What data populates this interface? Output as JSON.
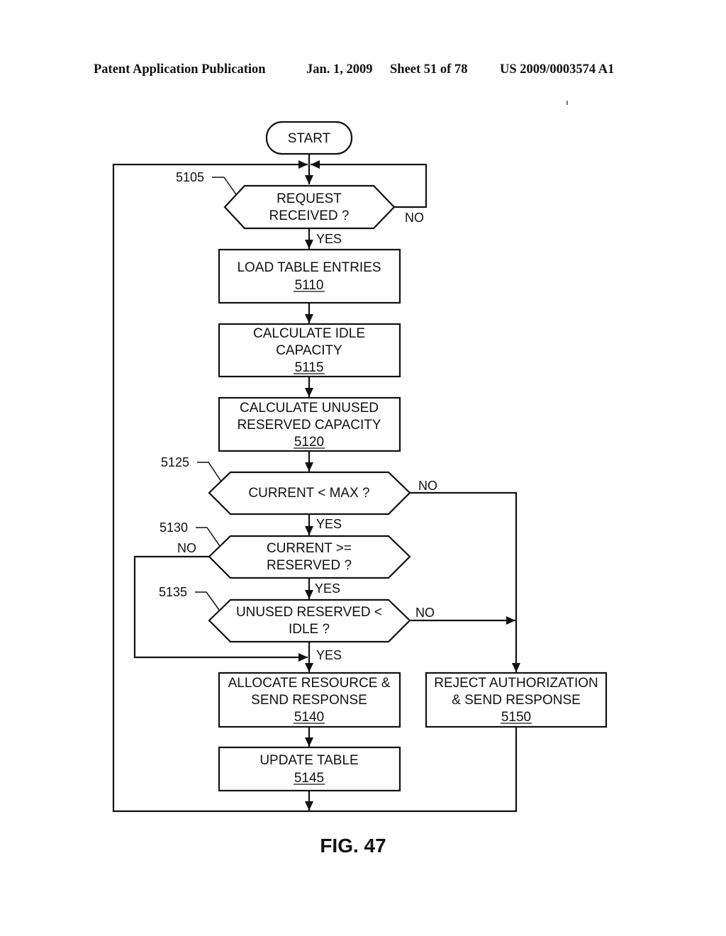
{
  "header": {
    "publication": "Patent Application Publication",
    "date": "Jan. 1, 2009",
    "sheet": "Sheet 51 of 78",
    "number": "US 2009/0003574 A1"
  },
  "figure": {
    "label": "FIG. 47"
  },
  "nodes": {
    "start": {
      "type": "terminal",
      "lines": [
        "START"
      ]
    },
    "n5105": {
      "type": "decision",
      "ref": "5105",
      "lines": [
        "REQUEST",
        "RECEIVED ?"
      ]
    },
    "n5110": {
      "type": "process",
      "ref": "5110",
      "lines": [
        "LOAD TABLE ENTRIES"
      ]
    },
    "n5115": {
      "type": "process",
      "ref": "5115",
      "lines": [
        "CALCULATE IDLE",
        "CAPACITY"
      ]
    },
    "n5120": {
      "type": "process",
      "ref": "5120",
      "lines": [
        "CALCULATE UNUSED",
        "RESERVED CAPACITY"
      ]
    },
    "n5125": {
      "type": "decision",
      "ref": "5125",
      "lines": [
        "CURRENT < MAX ?"
      ]
    },
    "n5130": {
      "type": "decision",
      "ref": "5130",
      "lines": [
        "CURRENT >=",
        "RESERVED ?"
      ]
    },
    "n5135": {
      "type": "decision",
      "ref": "5135",
      "lines": [
        "UNUSED RESERVED <",
        "IDLE ?"
      ]
    },
    "n5140": {
      "type": "process",
      "ref": "5140",
      "lines": [
        "ALLOCATE RESOURCE &",
        "SEND RESPONSE"
      ]
    },
    "n5145": {
      "type": "process",
      "ref": "5145",
      "lines": [
        "UPDATE TABLE"
      ]
    },
    "n5150": {
      "type": "process",
      "ref": "5150",
      "lines": [
        "REJECT AUTHORIZATION",
        "& SEND RESPONSE"
      ]
    }
  },
  "edges": {
    "e5105_no": {
      "from": "5105",
      "to": "5105",
      "label": "NO"
    },
    "e5105_yes": {
      "from": "5105",
      "to": "5110",
      "label": "YES"
    },
    "e5125_no": {
      "from": "5125",
      "to": "5150",
      "label": "NO"
    },
    "e5125_yes": {
      "from": "5125",
      "to": "5130",
      "label": "YES"
    },
    "e5130_no": {
      "from": "5130",
      "to": "5140",
      "label": "NO"
    },
    "e5130_yes": {
      "from": "5130",
      "to": "5135",
      "label": "YES"
    },
    "e5135_no": {
      "from": "5135",
      "to": "5150",
      "label": "NO"
    },
    "e5135_yes": {
      "from": "5135",
      "to": "5140",
      "label": "YES"
    }
  }
}
